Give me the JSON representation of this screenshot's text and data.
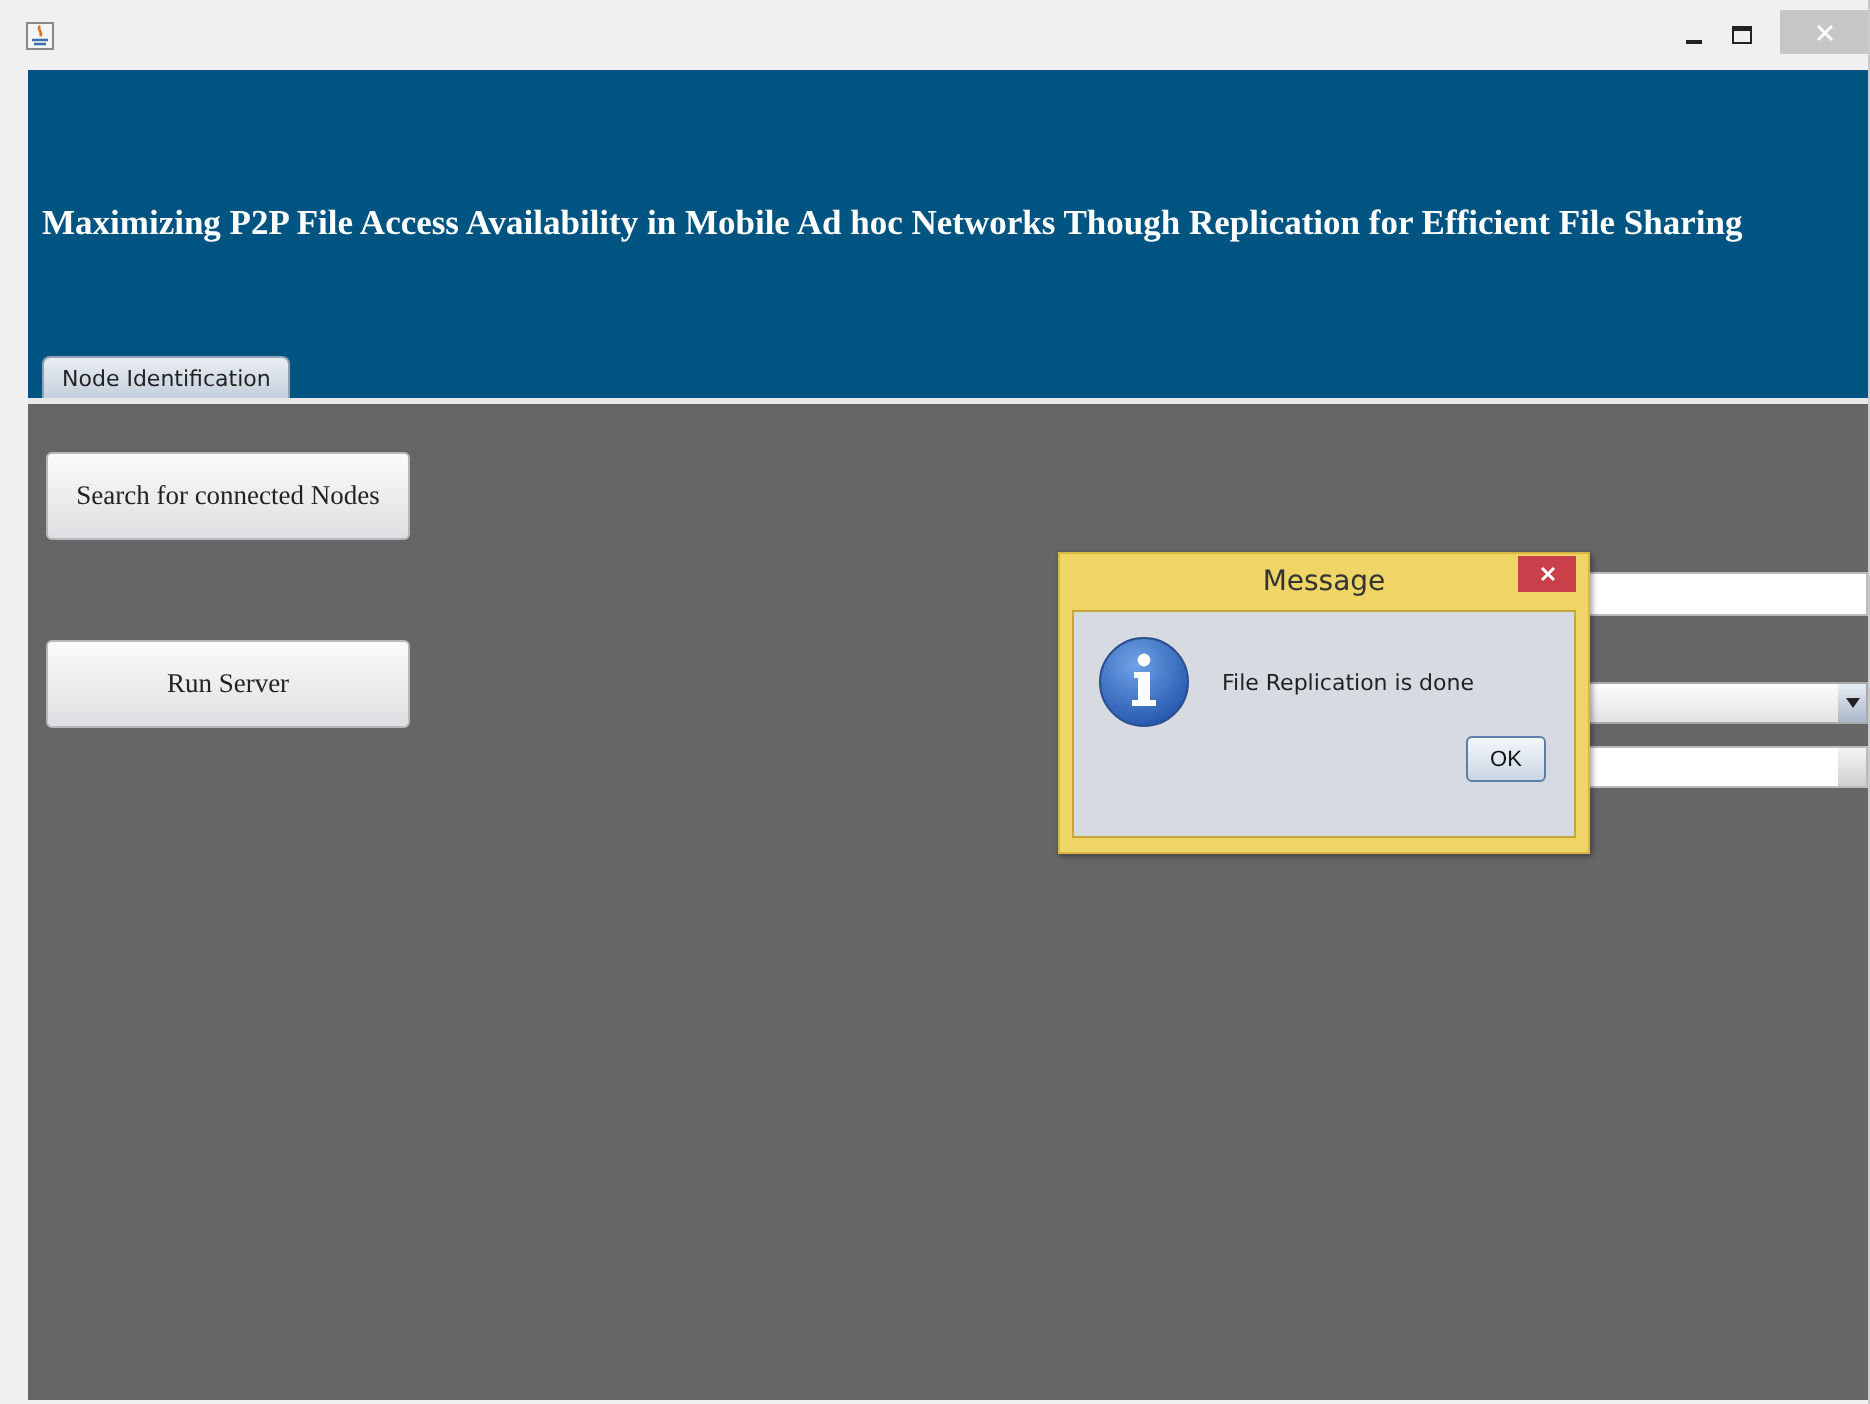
{
  "window": {
    "title_banner": "Maximizing P2P File Access Availability in Mobile Ad hoc Networks Though Replication for Efficient File Sharing"
  },
  "tabs": [
    {
      "label": "Node Identification",
      "selected": true
    }
  ],
  "buttons": [
    "Search for connected Nodes",
    "Run Server"
  ],
  "dialog": {
    "title": "Message",
    "message": "File Replication is done",
    "ok": "OK"
  }
}
